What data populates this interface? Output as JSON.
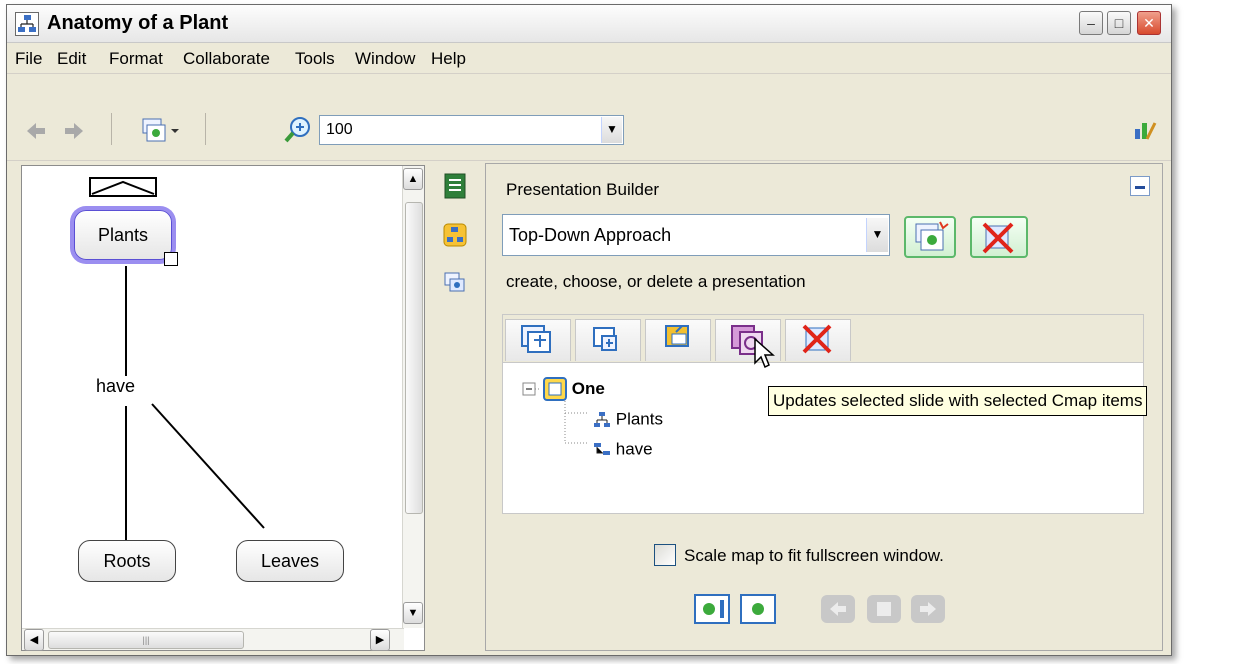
{
  "window": {
    "title": "Anatomy of a Plant",
    "controls": {
      "minimize": "–",
      "maximize": "□",
      "close": "✕"
    }
  },
  "menu": [
    "File",
    "Edit",
    "Format",
    "Collaborate",
    "Tools",
    "Window",
    "Help"
  ],
  "toolbar": {
    "zoom_value": "100"
  },
  "concept_map": {
    "concepts": {
      "plants": "Plants",
      "roots": "Roots",
      "leaves": "Leaves"
    },
    "link_label": "have"
  },
  "presentation": {
    "title": "Presentation Builder",
    "selected": "Top-Down Approach",
    "hint": "create, choose, or delete a presentation",
    "slides": {
      "slide_name": "One",
      "items": [
        "Plants",
        "have"
      ]
    },
    "tooltip": "Updates selected slide with selected Cmap items",
    "scale_option": "Scale map to fit fullscreen window.",
    "scale_checked": false
  },
  "colors": {
    "selection_glow": "#9b8ef0",
    "green_button": "#5cb86a",
    "tooltip_bg": "#ffffe1"
  }
}
